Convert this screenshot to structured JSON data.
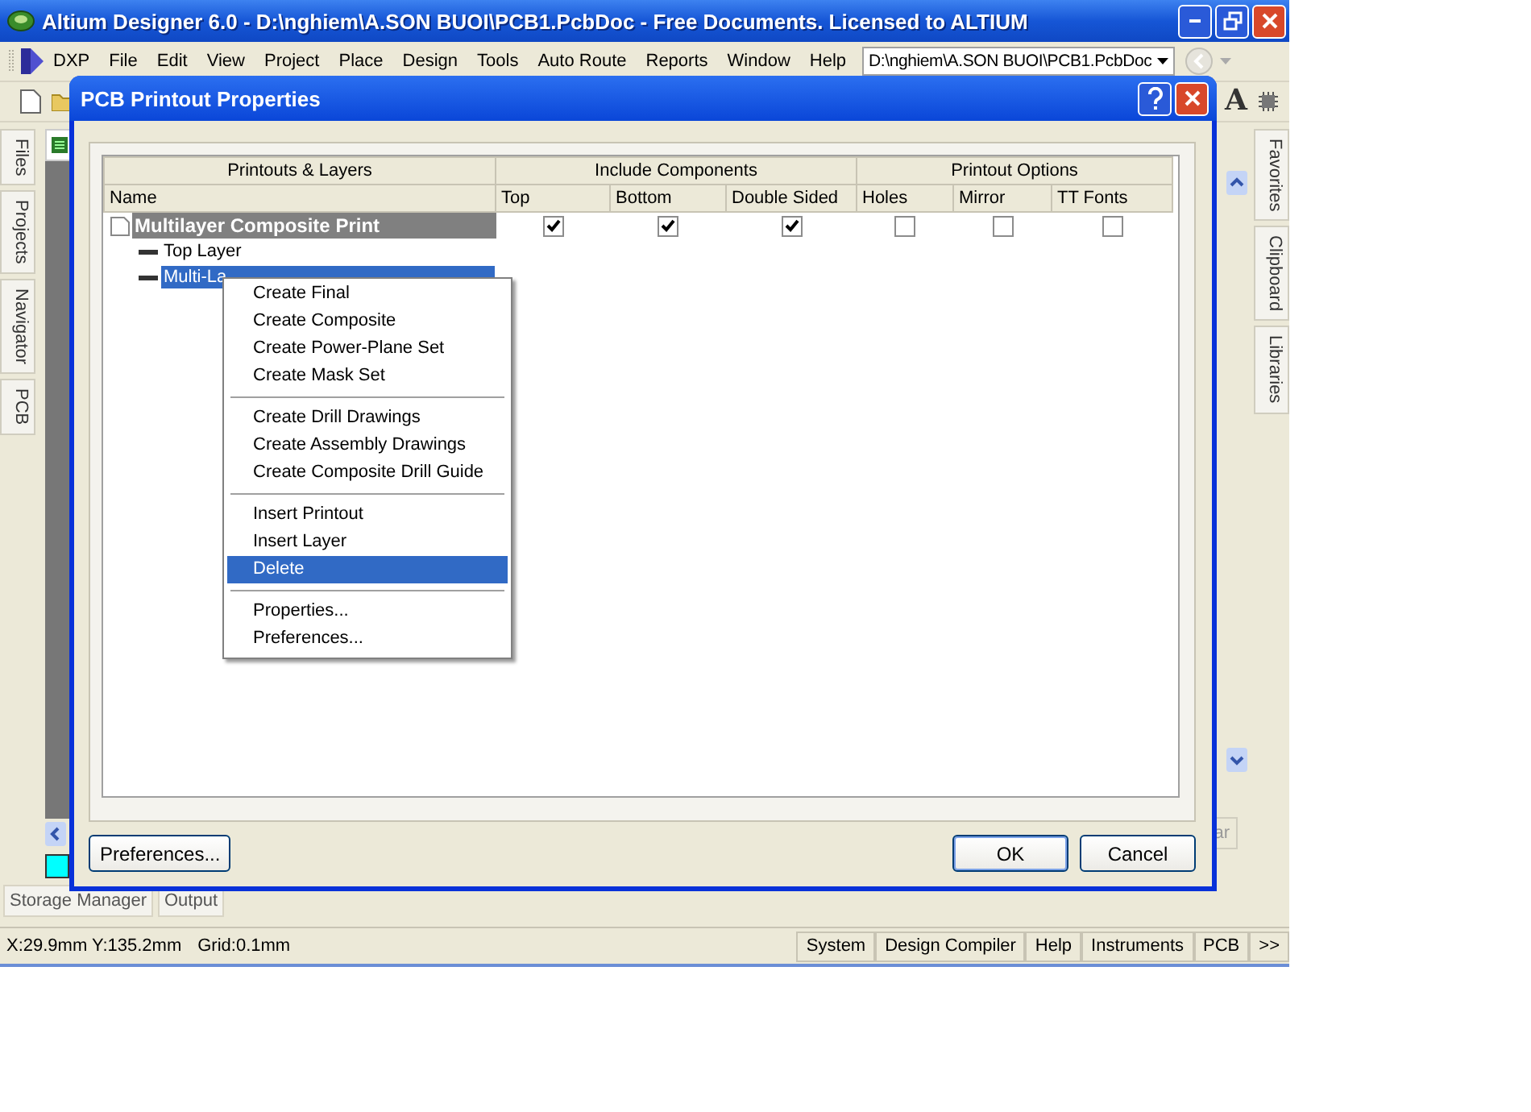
{
  "window": {
    "title": "Altium Designer 6.0 - D:\\nghiem\\A.SON BUOI\\PCB1.PcbDoc - Free Documents. Licensed to ALTIUM"
  },
  "menu": [
    "DXP",
    "File",
    "Edit",
    "View",
    "Project",
    "Place",
    "Design",
    "Tools",
    "Auto Route",
    "Reports",
    "Window",
    "Help"
  ],
  "document_path": "D:\\nghiem\\A.SON BUOI\\PCB1.PcbDoc",
  "left_panels": [
    "Files",
    "Projects",
    "Navigator",
    "PCB"
  ],
  "right_panels": [
    "Favorites",
    "Clipboard",
    "Libraries"
  ],
  "hidden_panel_tab": "ar",
  "toolbar_glyph": "A",
  "bottom_panels": [
    "Storage Manager",
    "Output"
  ],
  "status_bar": {
    "coordinates": "X:29.9mm Y:135.2mm",
    "grid": "Grid:0.1mm",
    "buttons": [
      "System",
      "Design Compiler",
      "Help",
      "Instruments",
      "PCB",
      ">>"
    ]
  },
  "dialog": {
    "title": "PCB Printout Properties",
    "groups": [
      {
        "label": "Printouts & Layers",
        "columns": [
          "Name"
        ]
      },
      {
        "label": "Include Components",
        "columns": [
          "Top",
          "Bottom",
          "Double Sided"
        ]
      },
      {
        "label": "Printout Options",
        "columns": [
          "Holes",
          "Mirror",
          "TT Fonts"
        ]
      }
    ],
    "rows": [
      {
        "kind": "printout",
        "name": "Multilayer Composite Print",
        "selected": false,
        "options": [
          true,
          true,
          true,
          false,
          false,
          false
        ]
      },
      {
        "kind": "layer",
        "name": "Top Layer",
        "selected": false
      },
      {
        "kind": "layer",
        "name": "Multi-La",
        "selected": true
      }
    ],
    "context_menu": [
      [
        {
          "label": "Create Final",
          "selected": false
        },
        {
          "label": "Create Composite",
          "selected": false
        },
        {
          "label": "Create Power-Plane Set",
          "selected": false
        },
        {
          "label": "Create Mask Set",
          "selected": false
        }
      ],
      [
        {
          "label": "Create Drill Drawings",
          "selected": false
        },
        {
          "label": "Create Assembly Drawings",
          "selected": false
        },
        {
          "label": "Create Composite Drill Guide",
          "selected": false
        }
      ],
      [
        {
          "label": "Insert Printout",
          "selected": false
        },
        {
          "label": "Insert Layer",
          "selected": false
        },
        {
          "label": "Delete",
          "selected": true
        }
      ],
      [
        {
          "label": "Properties...",
          "selected": false
        },
        {
          "label": "Preferences...",
          "selected": false
        }
      ]
    ],
    "left_button": "Preferences...",
    "buttons": [
      "OK",
      "Cancel"
    ]
  }
}
